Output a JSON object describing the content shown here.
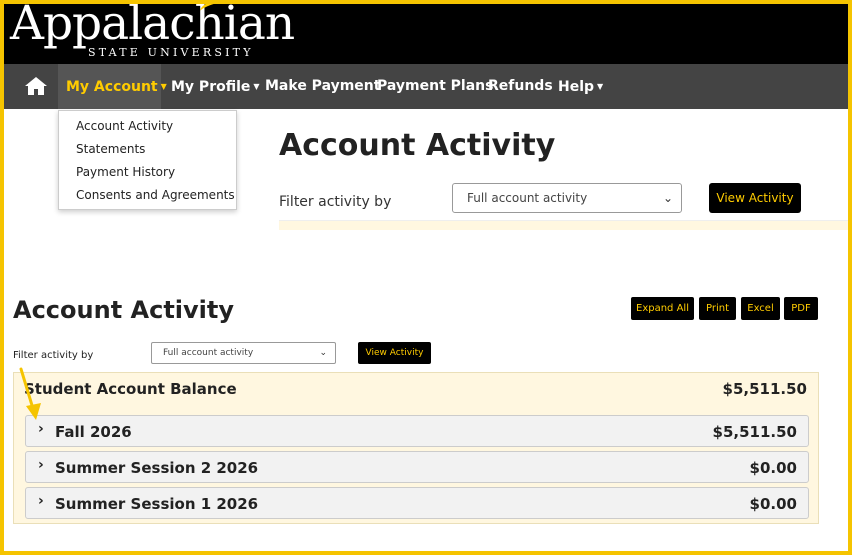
{
  "header": {
    "logo_word": "Appalachian",
    "logo_sub": "STATE UNIVERSITY"
  },
  "nav": {
    "items": [
      {
        "label": "My Account",
        "caret": true,
        "active": true
      },
      {
        "label": "My Profile",
        "caret": true
      },
      {
        "label": "Make Payment"
      },
      {
        "label": "Payment Plans"
      },
      {
        "label": "Refunds"
      },
      {
        "label": "Help",
        "caret": true
      }
    ],
    "home_icon": "home-icon"
  },
  "dropdown": {
    "items": [
      "Account Activity",
      "Statements",
      "Payment History",
      "Consents and Agreements"
    ]
  },
  "hero": {
    "title": "Account Activity",
    "filter_label": "Filter activity by",
    "select_value": "Full account activity",
    "button": "View Activity"
  },
  "section": {
    "title": "Account Activity",
    "tools": [
      "Expand All",
      "Print",
      "Excel",
      "PDF"
    ],
    "filter_label": "Filter activity by",
    "select_value": "Full account activity",
    "button": "View Activity"
  },
  "balance": {
    "label": "Student Account Balance",
    "amount": "$5,511.50",
    "terms": [
      {
        "name": "Fall 2026",
        "amount": "$5,511.50"
      },
      {
        "name": "Summer Session 2 2026",
        "amount": "$0.00"
      },
      {
        "name": "Summer Session 1 2026",
        "amount": "$0.00"
      }
    ]
  },
  "colors": {
    "accent": "#ffcc00",
    "nav_bg": "#444444",
    "balance_bg": "#fff7e0",
    "annotation": "#f5c400"
  }
}
